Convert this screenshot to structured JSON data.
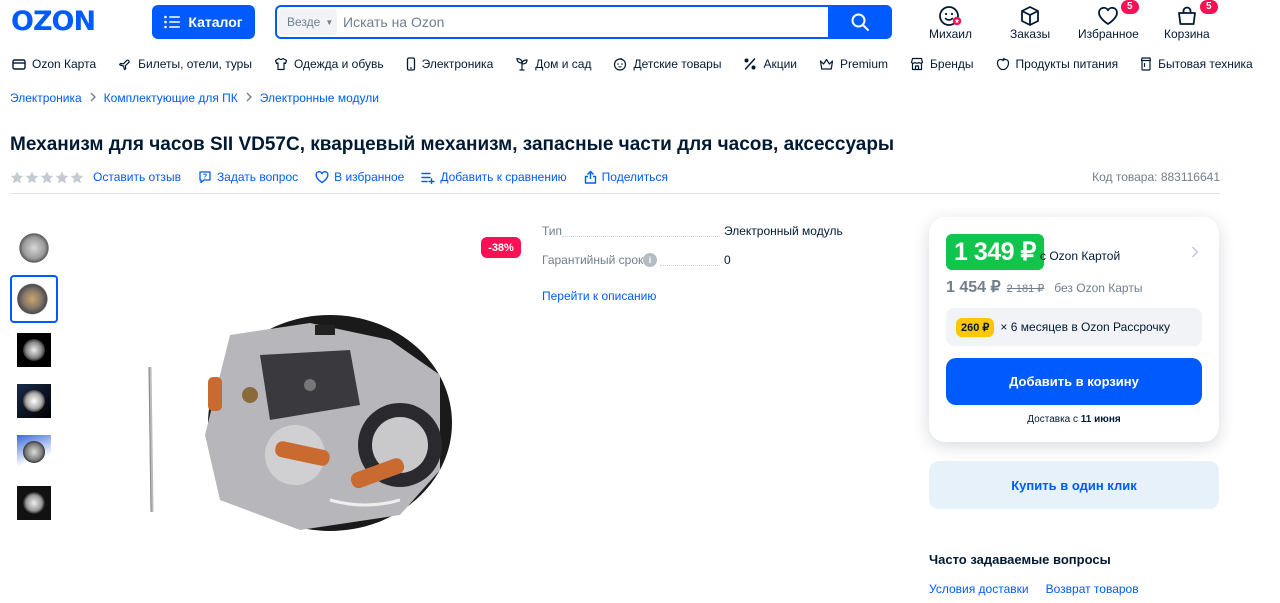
{
  "header": {
    "logo": "OZON",
    "catalog_label": "Каталог",
    "search_scope": "Везде",
    "search_placeholder": "Искать на Ozon",
    "actions": [
      {
        "label": "Михаил",
        "icon": "profile-icon"
      },
      {
        "label": "Заказы",
        "icon": "box-icon"
      },
      {
        "label": "Избранное",
        "icon": "heart-icon",
        "badge": "5"
      },
      {
        "label": "Корзина",
        "icon": "bag-icon",
        "badge": "5"
      }
    ]
  },
  "nav": [
    {
      "label": "Ozon Карта",
      "icon": "card-icon"
    },
    {
      "label": "Билеты, отели, туры",
      "icon": "plane-icon"
    },
    {
      "label": "Одежда и обувь",
      "icon": "shirt-icon"
    },
    {
      "label": "Электроника",
      "icon": "phone-icon"
    },
    {
      "label": "Дом и сад",
      "icon": "plant-icon"
    },
    {
      "label": "Детские товары",
      "icon": "baby-icon"
    },
    {
      "label": "Акции",
      "icon": "percent-icon"
    },
    {
      "label": "Premium",
      "icon": "crown-icon"
    },
    {
      "label": "Бренды",
      "icon": "store-icon"
    },
    {
      "label": "Продукты питания",
      "icon": "food-icon"
    },
    {
      "label": "Бытовая техника",
      "icon": "appliance-icon"
    }
  ],
  "breadcrumbs": [
    "Электроника",
    "Комплектующие для ПК",
    "Электронные модули"
  ],
  "product": {
    "title": "Механизм для часов SII VD57C, кварцевый механизм, запасные части для часов, аксессуары",
    "rating_stars": 5,
    "actions": {
      "review": "Оставить отзыв",
      "question": "Задать вопрос",
      "favorite": "В избранное",
      "compare": "Добавить к сравнению",
      "share": "Поделиться"
    },
    "sku": "Код товара: 883116641",
    "discount_badge": "-38%",
    "specs": [
      {
        "name": "Тип",
        "value": "Электронный модуль"
      },
      {
        "name": "Гарантийный срок",
        "value": "0"
      }
    ],
    "goto_description": "Перейти к описанию"
  },
  "price": {
    "card_price": "1 349 ₽",
    "card_label": "с Ozon Картой",
    "regular_price": "1 454 ₽",
    "old_price": "2 181 ₽",
    "regular_label": "без Ozon Карты",
    "installment_amount": "260 ₽",
    "installment_text": "× 6 месяцев в Ozon Рассрочку",
    "add_to_cart": "Добавить в корзину",
    "delivery_prefix": "Доставка с",
    "delivery_date": "11 июня",
    "buy_one_click": "Купить в один клик"
  },
  "faq": {
    "title": "Часто задаваемые вопросы",
    "links": [
      "Условия доставки",
      "Возврат товаров"
    ]
  },
  "colors": {
    "accent": "#005bff",
    "sale": "#f91155",
    "card_price": "#10c44c",
    "installment": "#ffc700"
  }
}
